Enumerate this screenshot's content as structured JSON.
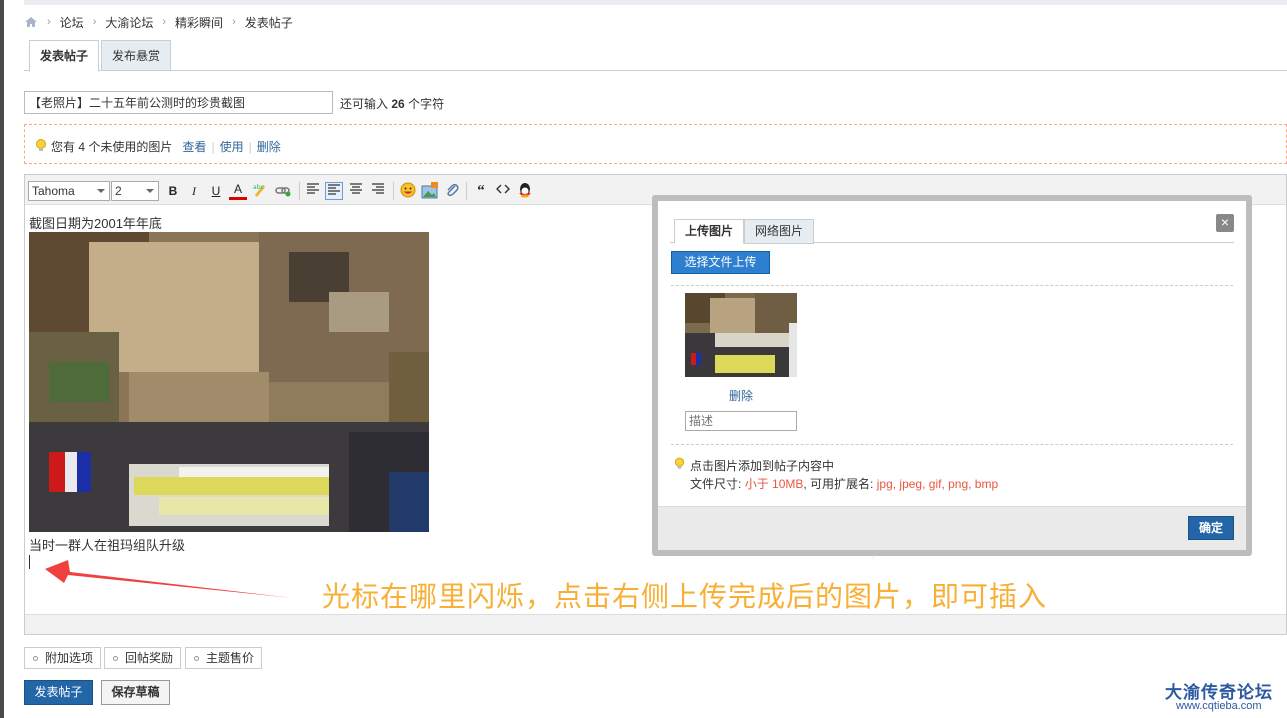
{
  "breadcrumb": [
    "论坛",
    "大渝论坛",
    "精彩瞬间",
    "发表帖子"
  ],
  "tabs": [
    "发表帖子",
    "发布悬赏"
  ],
  "subject": {
    "value": "【老照片】二十五年前公测时的珍贵截图",
    "remain_prefix": "还可输入",
    "remain_count": "26",
    "remain_suffix": "个字符"
  },
  "notice": {
    "text_prefix": "您有",
    "count": "4",
    "text_suffix": "个未使用的图片",
    "links": [
      "查看",
      "使用",
      "删除"
    ]
  },
  "toolbar": {
    "font": "Tahoma",
    "size": "2",
    "buttons": [
      "B",
      "I",
      "U",
      "A"
    ]
  },
  "editor": {
    "line1": "截图日期为2001年年底",
    "line2": "当时一群人在祖玛组队升级"
  },
  "instruction": "光标在哪里闪烁，点击右侧上传完成后的图片，即可插入",
  "options": [
    "附加选项",
    "回帖奖励",
    "主题售价"
  ],
  "buttons": {
    "submit": "发表帖子",
    "draft": "保存草稿"
  },
  "dialog": {
    "tabs": [
      "上传图片",
      "网络图片"
    ],
    "close": "×",
    "upload": "选择文件上传",
    "delete": "删除",
    "desc_placeholder": "描述",
    "tip1": "点击图片添加到帖子内容中",
    "tip2_label": "文件尺寸:",
    "tip2_size": "小于 10MB",
    "tip2_ext_label": ", 可用扩展名:",
    "tip2_exts": "jpg, jpeg, gif, png, bmp",
    "ok": "确定"
  },
  "watermark": {
    "title": "大渝传奇论坛",
    "url": "www.cqtieba.com"
  },
  "colors": {
    "accent": "#2366a8",
    "instruction": "#f7b035",
    "arrow": "#f04040"
  }
}
